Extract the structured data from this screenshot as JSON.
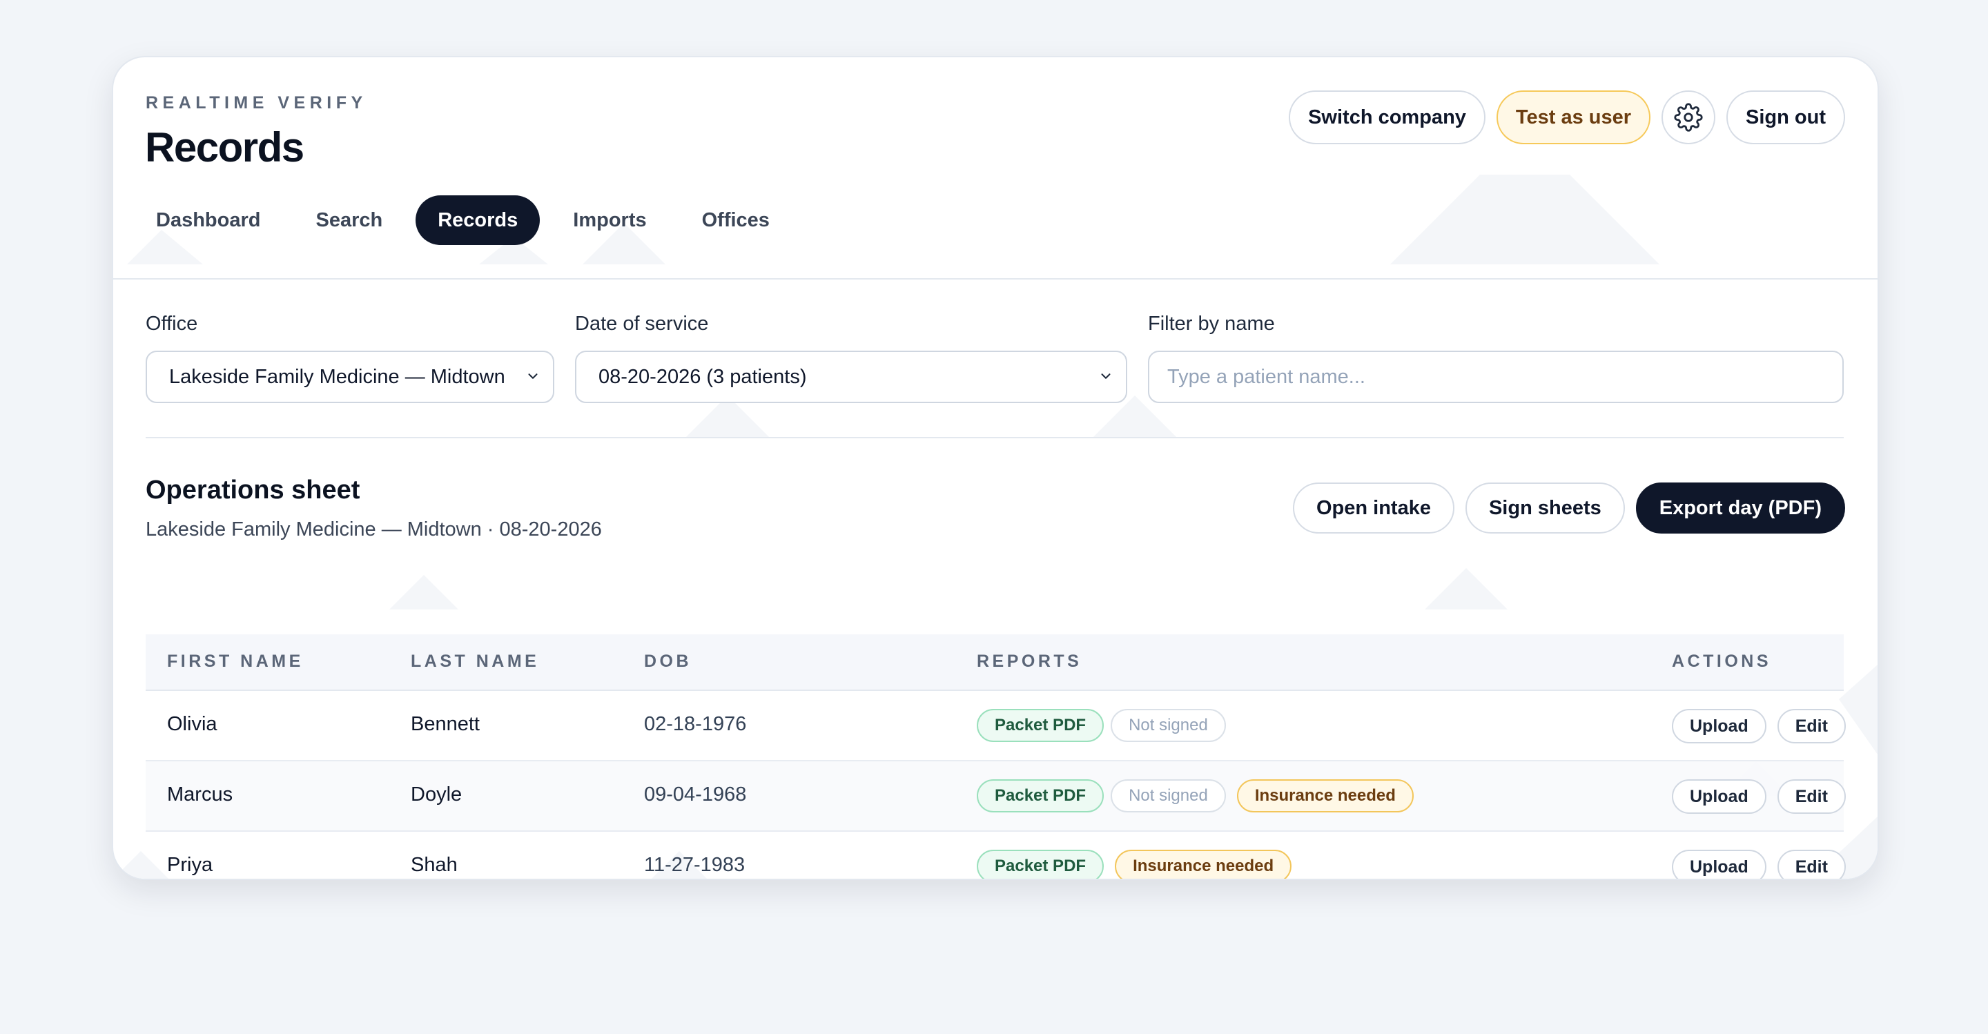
{
  "header": {
    "brand": "REALTIME VERIFY",
    "title": "Records",
    "actions": {
      "switch_company": "Switch company",
      "test_as_user": "Test as user",
      "settings_icon": "gear-icon",
      "sign_out": "Sign out"
    }
  },
  "tabs": [
    {
      "label": "Dashboard",
      "active": false
    },
    {
      "label": "Search",
      "active": false
    },
    {
      "label": "Records",
      "active": true
    },
    {
      "label": "Imports",
      "active": false
    },
    {
      "label": "Offices",
      "active": false
    }
  ],
  "filters": {
    "office": {
      "label": "Office",
      "value": "Lakeside Family Medicine — Midtown"
    },
    "date": {
      "label": "Date of service",
      "value": "08-20-2026 (3 patients)"
    },
    "name": {
      "label": "Filter by name",
      "placeholder": "Type a patient name..."
    }
  },
  "sheet": {
    "title": "Operations sheet",
    "subtitle": "Lakeside Family Medicine — Midtown · 08-20-2026",
    "actions": {
      "open_intake": "Open intake",
      "sign_sheets": "Sign sheets",
      "export_day": "Export day (PDF)"
    }
  },
  "table": {
    "columns": [
      "FIRST NAME",
      "LAST NAME",
      "DOB",
      "REPORTS",
      "ACTIONS"
    ],
    "rows": [
      {
        "first": "Olivia",
        "last": "Bennett",
        "dob": "02-18-1976",
        "badges": [
          "Packet PDF",
          "Not signed"
        ]
      },
      {
        "first": "Marcus",
        "last": "Doyle",
        "dob": "09-04-1968",
        "badges": [
          "Packet PDF",
          "Not signed",
          "Insurance needed"
        ]
      },
      {
        "first": "Priya",
        "last": "Shah",
        "dob": "11-27-1983",
        "badges": [
          "Packet PDF",
          "Insurance needed"
        ]
      }
    ],
    "row_actions": {
      "upload": "Upload",
      "edit": "Edit"
    }
  },
  "colors": {
    "background": "#f2f5f9",
    "primary_dark": "#0f172a",
    "warning_bg": "#fff8e6",
    "warning_border": "#f6c95a",
    "success_bg": "#edfaf3",
    "success_border": "#9ae0bc"
  }
}
